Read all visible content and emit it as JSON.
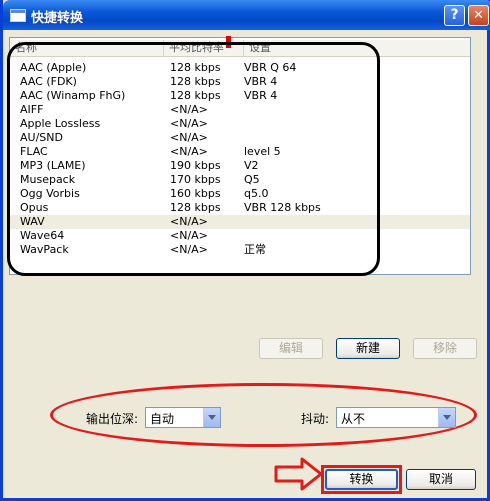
{
  "window": {
    "title": "快捷转换",
    "help_label": "?",
    "close_label": "✕"
  },
  "list": {
    "headers": [
      "名称",
      "平均比特率",
      "设置"
    ],
    "rows": [
      {
        "name": "AAC (Apple)",
        "bitrate": "128 kbps",
        "setting": "VBR Q 64"
      },
      {
        "name": "AAC (FDK)",
        "bitrate": "128 kbps",
        "setting": "VBR 4"
      },
      {
        "name": "AAC (Winamp FhG)",
        "bitrate": "128 kbps",
        "setting": "VBR 4"
      },
      {
        "name": "AIFF",
        "bitrate": "<N/A>",
        "setting": ""
      },
      {
        "name": "Apple Lossless",
        "bitrate": "<N/A>",
        "setting": ""
      },
      {
        "name": "AU/SND",
        "bitrate": "<N/A>",
        "setting": ""
      },
      {
        "name": "FLAC",
        "bitrate": "<N/A>",
        "setting": "level 5"
      },
      {
        "name": "MP3 (LAME)",
        "bitrate": "190 kbps",
        "setting": "V2"
      },
      {
        "name": "Musepack",
        "bitrate": "170 kbps",
        "setting": "Q5"
      },
      {
        "name": "Ogg Vorbis",
        "bitrate": "160 kbps",
        "setting": "q5.0"
      },
      {
        "name": "Opus",
        "bitrate": "128 kbps",
        "setting": "VBR 128 kbps"
      },
      {
        "name": "WAV",
        "bitrate": "<N/A>",
        "setting": ""
      },
      {
        "name": "Wave64",
        "bitrate": "<N/A>",
        "setting": ""
      },
      {
        "name": "WavPack",
        "bitrate": "<N/A>",
        "setting": "正常"
      }
    ],
    "selected_index": 11
  },
  "actions": {
    "edit_label": "编辑",
    "new_label": "新建",
    "remove_label": "移除"
  },
  "options": {
    "bit_depth_label": "输出位深:",
    "bit_depth_value": "自动",
    "dither_label": "抖动:",
    "dither_value": "从不"
  },
  "footer": {
    "convert_label": "转换",
    "cancel_label": "取消"
  },
  "colors": {
    "annotation_red": "#e21a1a",
    "titlebar_blue": "#0a57d6"
  }
}
